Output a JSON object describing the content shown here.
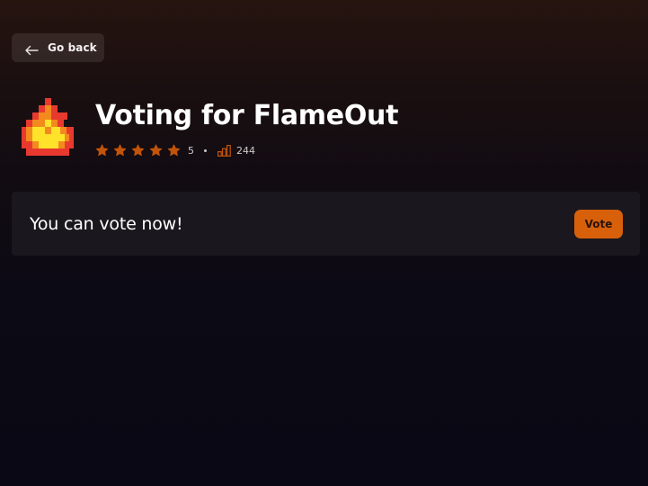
{
  "header": {
    "back_label": "Go back",
    "back_icon": "arrow-left-icon"
  },
  "game": {
    "title": "Voting for FlameOut",
    "logo_icon": "pixel-flame-icon",
    "rating": {
      "value": 5,
      "max": 5,
      "label": "5",
      "star_color": "#c2540a"
    },
    "votes_icon": "bar-chart-icon",
    "votes": "244"
  },
  "vote_panel": {
    "message": "You can vote now!",
    "button_label": "Vote",
    "button_color": "#d9600a"
  }
}
